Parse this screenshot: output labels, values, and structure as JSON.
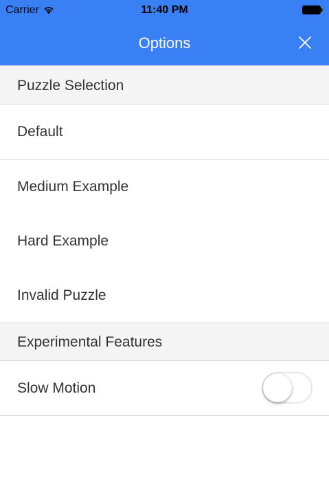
{
  "status_bar": {
    "carrier": "Carrier",
    "time": "11:40 PM",
    "wifi_icon": "wifi-icon",
    "battery_icon": "battery-icon"
  },
  "nav_bar": {
    "title": "Options",
    "close_icon": "close-icon",
    "background_color": "#3a80f5"
  },
  "sections": [
    {
      "header": "Puzzle Selection",
      "items": [
        "Default",
        "Medium Example",
        "Hard Example",
        "Invalid Puzzle"
      ]
    },
    {
      "header": "Experimental Features",
      "items": [
        {
          "label": "Slow Motion",
          "toggle_on": false
        }
      ]
    }
  ]
}
